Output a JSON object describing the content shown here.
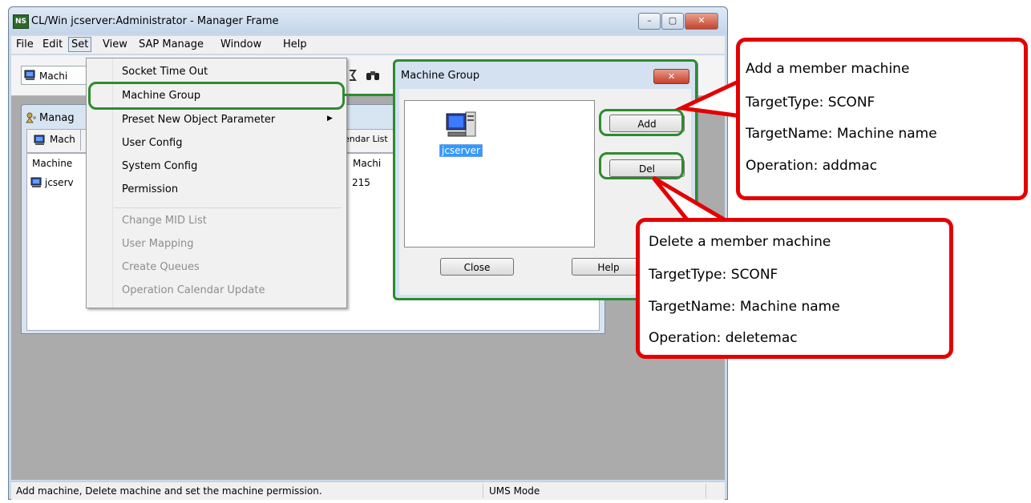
{
  "window": {
    "logo": "NS",
    "title": "CL/Win jcserver:Administrator - Manager Frame",
    "caption_buttons": {
      "minimize": "–",
      "maximize": "▢",
      "close": "✕"
    }
  },
  "menubar": [
    "File",
    "Edit",
    "Set",
    "View",
    "SAP Manage",
    "Window",
    "Help"
  ],
  "toolbar": {
    "machine_button": "Machi"
  },
  "child_window": {
    "title": "Manag",
    "tab_first": "Mach",
    "tab_calendar": "endar List",
    "columns": [
      "Machine",
      "Machi"
    ],
    "row": {
      "name": "jcserv",
      "value": "215"
    }
  },
  "set_menu": {
    "items": [
      "Socket Time Out",
      "Machine Group",
      "Preset New Object Parameter",
      "User Config",
      "System Config",
      "Permission"
    ],
    "disabled_items": [
      "Change MID List",
      "User Mapping",
      "Create Queues",
      "Operation Calendar Update"
    ],
    "submenu_arrow": "▶"
  },
  "dialog": {
    "title": "Machine Group",
    "close": "✕",
    "machine": "jcserver",
    "buttons": {
      "add": "Add",
      "del": "Del",
      "close": "Close",
      "help": "Help"
    }
  },
  "statusbar": {
    "text": "Add machine, Delete machine and set the machine permission.",
    "mode": "UMS Mode"
  },
  "callouts": {
    "add": [
      "Add a member machine",
      "TargetType: SCONF",
      "TargetName: Machine name",
      "Operation: addmac"
    ],
    "delete": [
      "Delete a member machine",
      "TargetType: SCONF",
      "TargetName: Machine name",
      "Operation: deletemac"
    ]
  },
  "colors": {
    "highlight_green": "#2e8b2e",
    "callout_red": "#e30000",
    "selection_blue": "#3399ff"
  }
}
